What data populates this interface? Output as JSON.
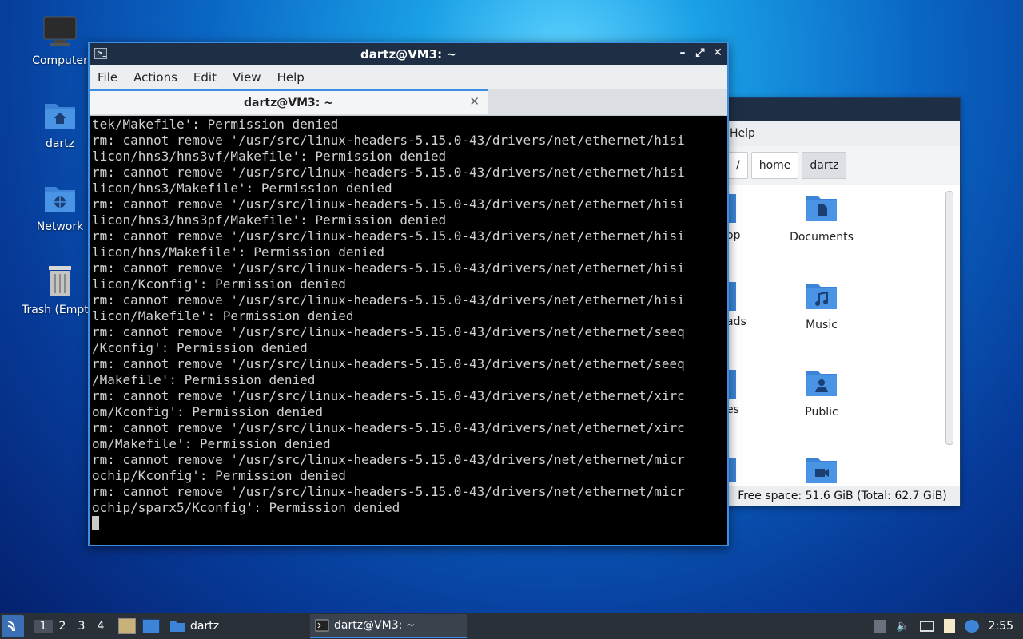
{
  "desktop": {
    "icons": [
      {
        "label": "Computer"
      },
      {
        "label": "dartz"
      },
      {
        "label": "Network"
      },
      {
        "label": "Trash (Empty)"
      }
    ]
  },
  "file_manager": {
    "menu_partial": "Help",
    "breadcrumbs": [
      "/",
      "home",
      "dartz"
    ],
    "items": [
      {
        "label": "Documents"
      },
      {
        "label": "Music"
      },
      {
        "label": "Public"
      }
    ],
    "partial_labels": [
      "op",
      "ads",
      "es"
    ],
    "status": "Free space: 51.6 GiB (Total: 62.7 GiB)"
  },
  "terminal": {
    "title": "dartz@VM3: ~",
    "menu": [
      "File",
      "Actions",
      "Edit",
      "View",
      "Help"
    ],
    "tab_title": "dartz@VM3: ~",
    "output": "tek/Makefile': Permission denied\nrm: cannot remove '/usr/src/linux-headers-5.15.0-43/drivers/net/ethernet/hisi\nlicon/hns3/hns3vf/Makefile': Permission denied\nrm: cannot remove '/usr/src/linux-headers-5.15.0-43/drivers/net/ethernet/hisi\nlicon/hns3/Makefile': Permission denied\nrm: cannot remove '/usr/src/linux-headers-5.15.0-43/drivers/net/ethernet/hisi\nlicon/hns3/hns3pf/Makefile': Permission denied\nrm: cannot remove '/usr/src/linux-headers-5.15.0-43/drivers/net/ethernet/hisi\nlicon/hns/Makefile': Permission denied\nrm: cannot remove '/usr/src/linux-headers-5.15.0-43/drivers/net/ethernet/hisi\nlicon/Kconfig': Permission denied\nrm: cannot remove '/usr/src/linux-headers-5.15.0-43/drivers/net/ethernet/hisi\nlicon/Makefile': Permission denied\nrm: cannot remove '/usr/src/linux-headers-5.15.0-43/drivers/net/ethernet/seeq\n/Kconfig': Permission denied\nrm: cannot remove '/usr/src/linux-headers-5.15.0-43/drivers/net/ethernet/seeq\n/Makefile': Permission denied\nrm: cannot remove '/usr/src/linux-headers-5.15.0-43/drivers/net/ethernet/xirc\nom/Kconfig': Permission denied\nrm: cannot remove '/usr/src/linux-headers-5.15.0-43/drivers/net/ethernet/xirc\nom/Makefile': Permission denied\nrm: cannot remove '/usr/src/linux-headers-5.15.0-43/drivers/net/ethernet/micr\nochip/Kconfig': Permission denied\nrm: cannot remove '/usr/src/linux-headers-5.15.0-43/drivers/net/ethernet/micr\nochip/sparx5/Kconfig': Permission denied\n"
  },
  "taskbar": {
    "workspaces": [
      "1",
      "2",
      "3",
      "4"
    ],
    "tasks": [
      {
        "label": "dartz",
        "icon": "folder-icon"
      },
      {
        "label": "dartz@VM3: ~",
        "icon": "terminal-icon"
      }
    ],
    "clock": "2:55"
  },
  "colors": {
    "accent": "#3d8ee0",
    "titlebar": "#1e2f45",
    "folder": "#3b84d8"
  }
}
